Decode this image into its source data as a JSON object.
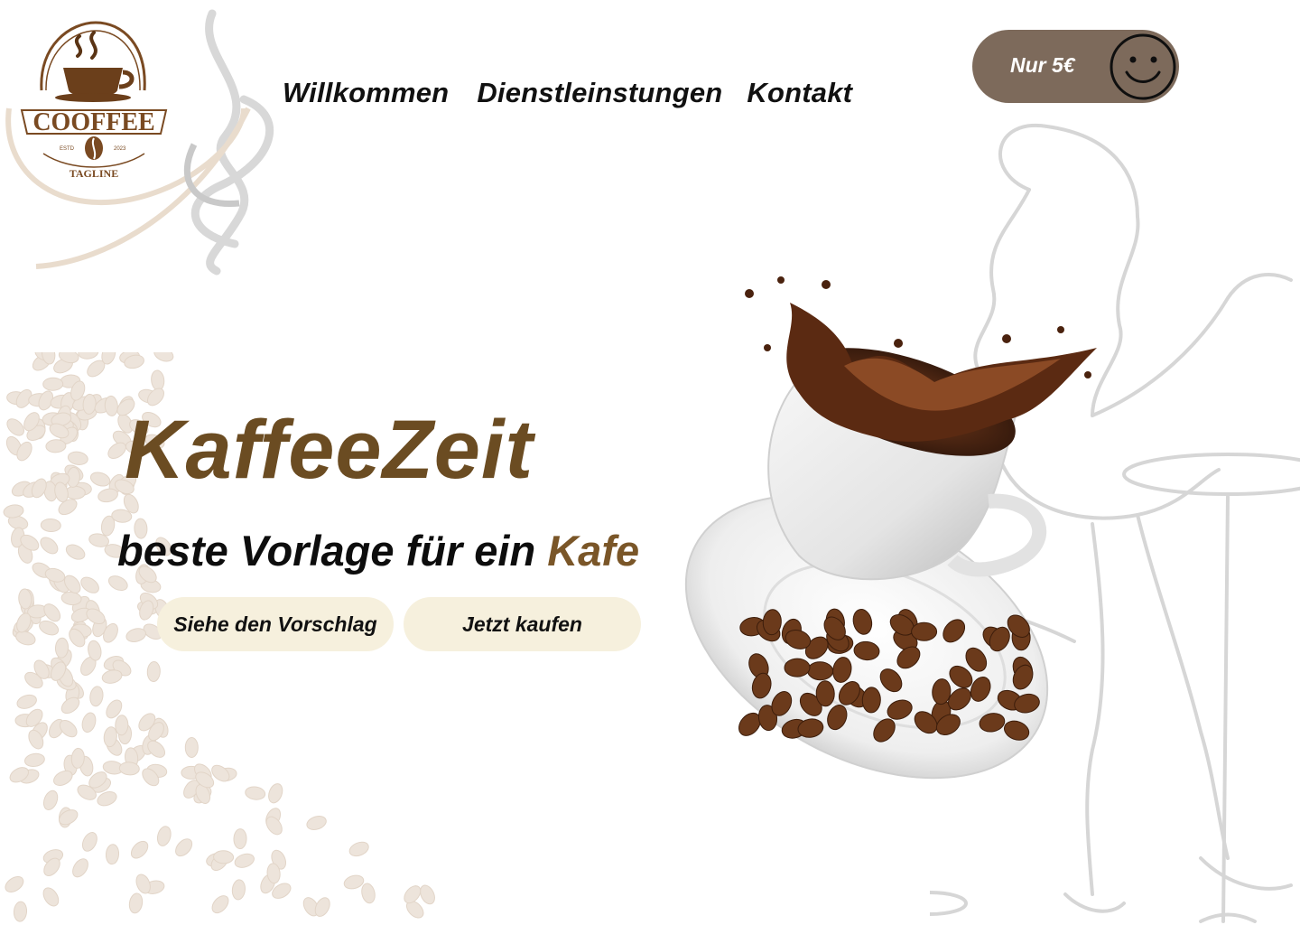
{
  "brand": {
    "logo_text": "COOFFEE",
    "logo_tagline": "TAGLINE",
    "logo_est": "ESTD",
    "logo_year": "2023"
  },
  "nav": {
    "items": [
      {
        "label": "Willkommen"
      },
      {
        "label": "Dienstleinstungen"
      },
      {
        "label": "Kontakt"
      }
    ]
  },
  "price_badge": {
    "label": "Nur 5€",
    "icon": "smiley-icon"
  },
  "hero": {
    "title": "KaffeeZeit",
    "subtitle_main": "beste Vorlage für ein ",
    "subtitle_accent": "Kafe",
    "buttons": {
      "primary": "Siehe den Vorschlag",
      "secondary": "Jetzt kaufen"
    }
  },
  "colors": {
    "title_brown": "#6b4c22",
    "accent_brown": "#7a5628",
    "pill_brown": "#7d6a5b",
    "button_cream": "#f6f0dd"
  }
}
